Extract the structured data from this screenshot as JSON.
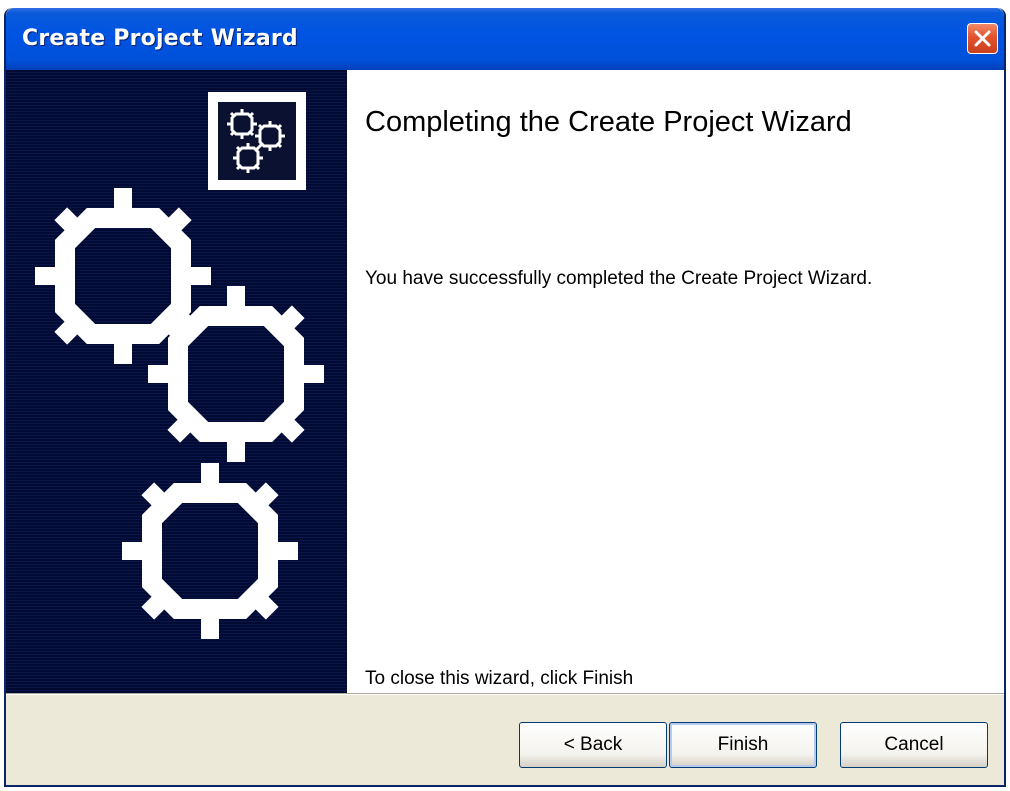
{
  "window": {
    "title": "Create Project Wizard"
  },
  "content": {
    "heading": "Completing the Create Project Wizard",
    "message": "You have successfully completed the Create Project Wizard.",
    "close_hint": "To close this wizard, click Finish"
  },
  "buttons": {
    "back_label": "< Back",
    "finish_label": "Finish",
    "cancel_label": "Cancel"
  },
  "icons": {
    "title_close": "close-icon",
    "banner_small": "gears-icon",
    "banner_large": "gears-graphic"
  },
  "colors": {
    "titlebar": "#0054e3",
    "banner": "#000a33",
    "close_button": "#e2532d",
    "dialog_background": "#ece9d8"
  }
}
